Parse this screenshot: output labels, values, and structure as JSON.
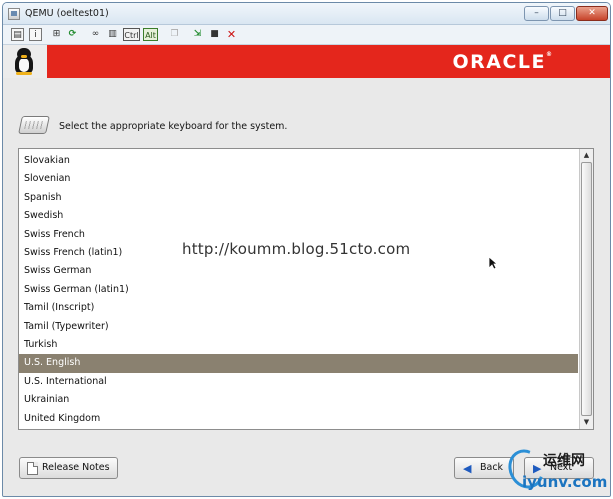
{
  "window": {
    "title": "QEMU (oeltest01)",
    "controls": {
      "minimize": "–",
      "maximize": "□",
      "close": "✕"
    }
  },
  "toolbar": {
    "ctrl_label": "Ctrl",
    "alt_label": "Alt",
    "icons": [
      "properties-icon",
      "info-icon",
      "grid-icon",
      "refresh-icon",
      "link-icon",
      "bookshelf-icon",
      "ctrl-key-icon",
      "alt-key-icon",
      "copy-icon",
      "import-icon",
      "save-icon",
      "close-x-icon"
    ]
  },
  "banner": {
    "brand": "ORACLE",
    "brand_mark": "®",
    "color": "#e4261c"
  },
  "prompt": {
    "text": "Select the appropriate keyboard for the system."
  },
  "keyboard_list": {
    "items": [
      "Slovakian",
      "Slovenian",
      "Spanish",
      "Swedish",
      "Swiss French",
      "Swiss French (latin1)",
      "Swiss German",
      "Swiss German (latin1)",
      "Tamil (Inscript)",
      "Tamil (Typewriter)",
      "Turkish",
      "U.S. English",
      "U.S. International",
      "Ukrainian",
      "United Kingdom"
    ],
    "selected": "U.S. English",
    "selected_color": "#8a8170"
  },
  "watermark": "http://koumm.blog.51cto.com",
  "buttons": {
    "release_notes": "Release Notes",
    "back": "Back",
    "next": "Next"
  },
  "site_logo": {
    "cn": "运维网",
    "url": "iyunv.com"
  }
}
